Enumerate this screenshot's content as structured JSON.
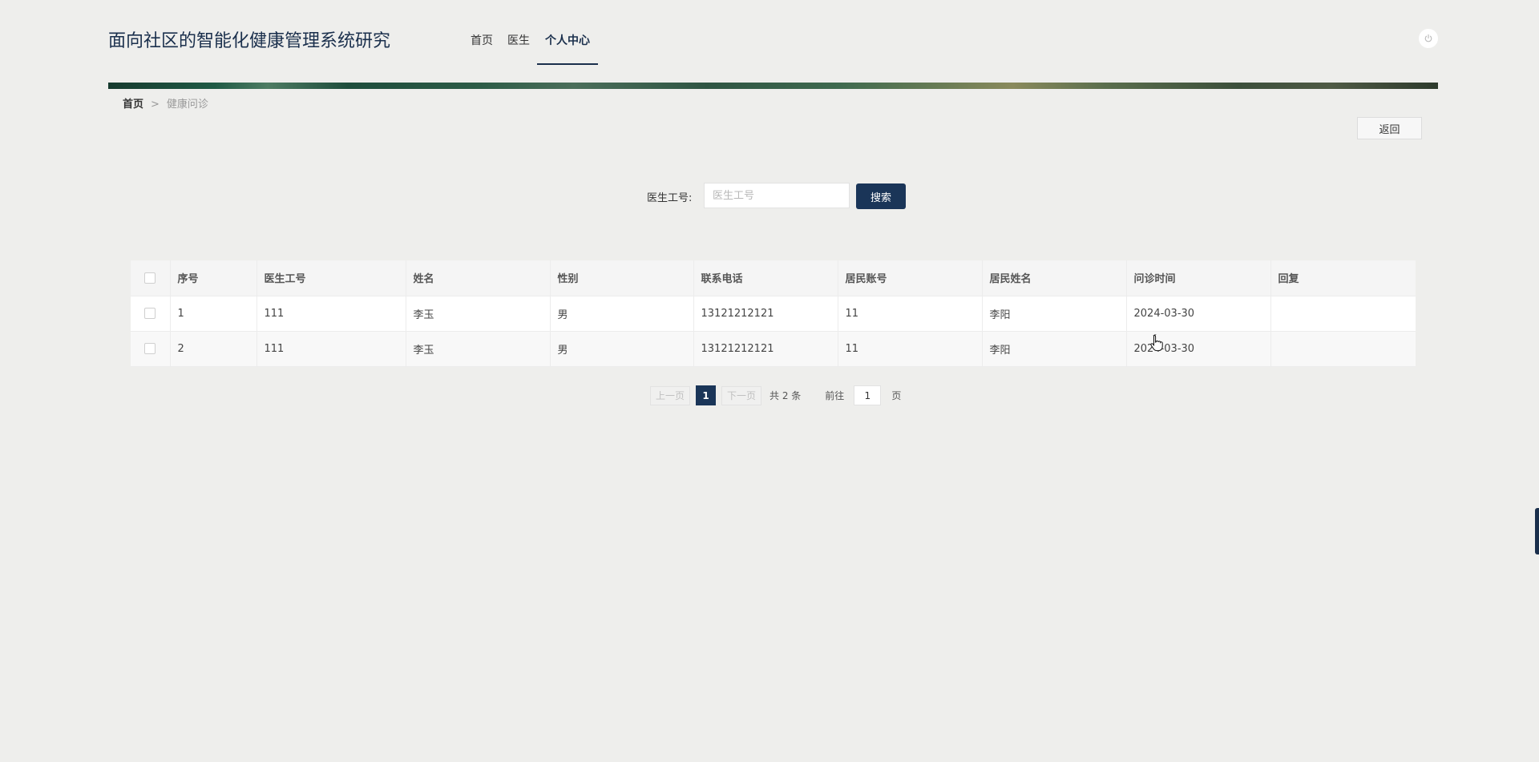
{
  "header": {
    "site_title": "面向社区的智能化健康管理系统研究",
    "nav": [
      {
        "label": "首页",
        "active": false
      },
      {
        "label": "医生",
        "active": false
      },
      {
        "label": "个人中心",
        "active": true
      }
    ],
    "power_icon": "power-icon"
  },
  "breadcrumb": {
    "home": "首页",
    "separator": ">",
    "current": "健康问诊"
  },
  "actions": {
    "back_label": "返回"
  },
  "search": {
    "label": "医生工号:",
    "placeholder": "医生工号",
    "value": "",
    "button_label": "搜索"
  },
  "table": {
    "headers": [
      "序号",
      "医生工号",
      "姓名",
      "性别",
      "联系电话",
      "居民账号",
      "居民姓名",
      "问诊时间",
      "回复"
    ],
    "rows": [
      [
        "1",
        "111",
        "李玉",
        "男",
        "13121212121",
        "11",
        "李阳",
        "2024-03-30",
        ""
      ],
      [
        "2",
        "111",
        "李玉",
        "男",
        "13121212121",
        "11",
        "李阳",
        "2024-03-30",
        ""
      ]
    ]
  },
  "pagination": {
    "prev_label": "上一页",
    "current_page": "1",
    "next_label": "下一页",
    "total_text": "共 2 条",
    "goto_label": "前往",
    "goto_value": "1",
    "page_unit": "页"
  },
  "colors": {
    "primary": "#1a3558",
    "background": "#eeeeec"
  }
}
